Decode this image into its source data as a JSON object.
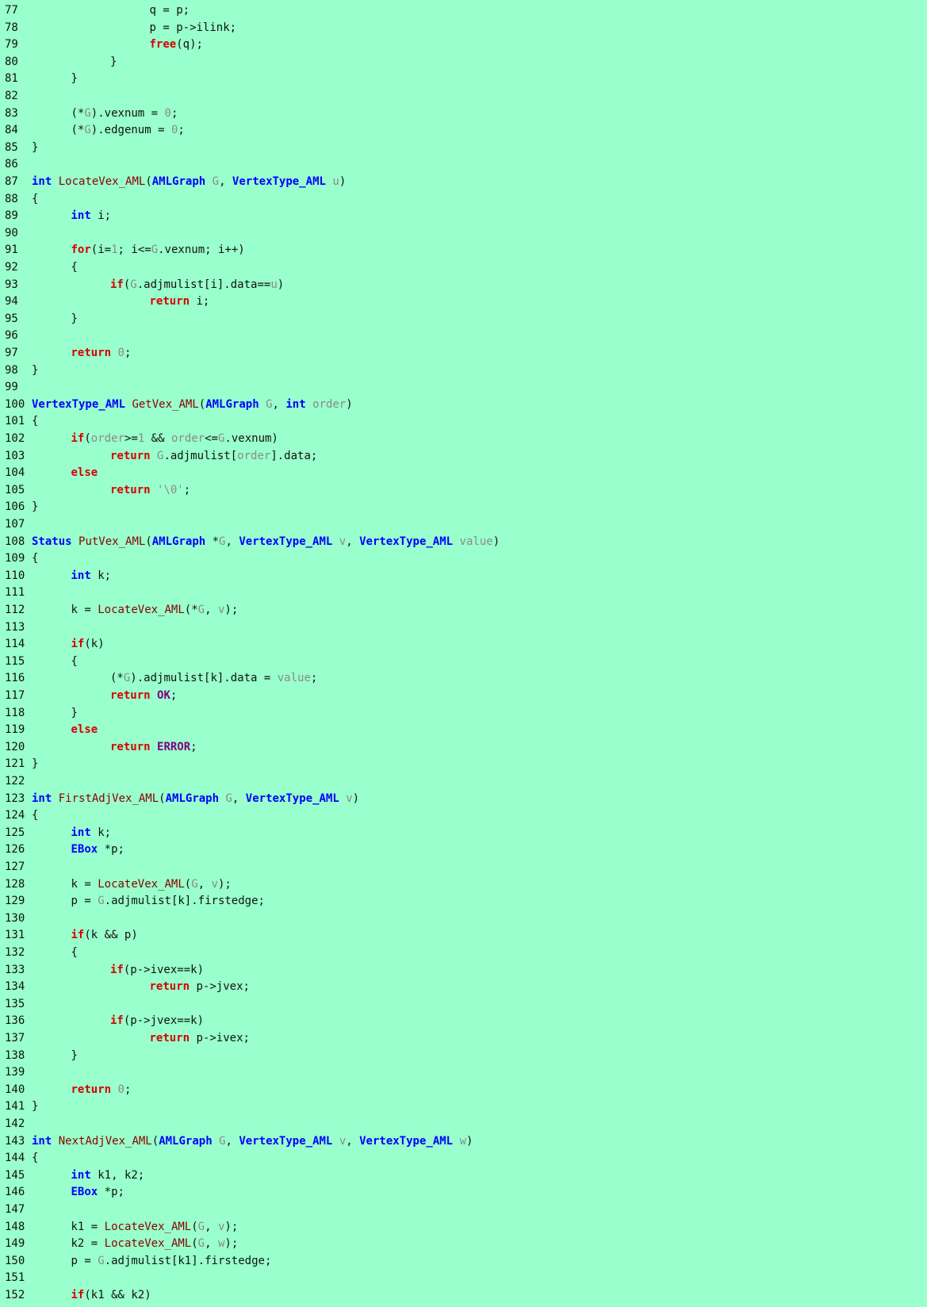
{
  "colors": {
    "background": "#99ffcc",
    "keyword": "#d60000",
    "type": "#0000ff",
    "function": "#8b0000",
    "identifier": "#8a8a8a",
    "constant": "#800080",
    "text": "#111111"
  },
  "lines": [
    {
      "n": "77",
      "indent": 3,
      "tokens": [
        [
          "plain",
          "q = p;"
        ]
      ]
    },
    {
      "n": "78",
      "indent": 3,
      "tokens": [
        [
          "plain",
          "p = p->ilink;"
        ]
      ]
    },
    {
      "n": "79",
      "indent": 3,
      "tokens": [
        [
          "kw",
          "free"
        ],
        [
          "plain",
          "(q);"
        ]
      ]
    },
    {
      "n": "80",
      "indent": 2,
      "tokens": [
        [
          "plain",
          "}"
        ]
      ]
    },
    {
      "n": "81",
      "indent": 1,
      "tokens": [
        [
          "plain",
          "}"
        ]
      ]
    },
    {
      "n": "82",
      "indent": 0,
      "tokens": []
    },
    {
      "n": "83",
      "indent": 1,
      "tokens": [
        [
          "plain",
          "(*"
        ],
        [
          "id",
          "G"
        ],
        [
          "plain",
          ").vexnum = "
        ],
        [
          "num",
          "0"
        ],
        [
          "plain",
          ";"
        ]
      ]
    },
    {
      "n": "84",
      "indent": 1,
      "tokens": [
        [
          "plain",
          "(*"
        ],
        [
          "id",
          "G"
        ],
        [
          "plain",
          ").edgenum = "
        ],
        [
          "num",
          "0"
        ],
        [
          "plain",
          ";"
        ]
      ]
    },
    {
      "n": "85",
      "indent": 0,
      "tokens": [
        [
          "plain",
          "}"
        ]
      ]
    },
    {
      "n": "86",
      "indent": 0,
      "tokens": []
    },
    {
      "n": "87",
      "indent": 0,
      "tokens": [
        [
          "type",
          "int"
        ],
        [
          "plain",
          " "
        ],
        [
          "fn",
          "LocateVex_AML"
        ],
        [
          "plain",
          "("
        ],
        [
          "type",
          "AMLGraph"
        ],
        [
          "plain",
          " "
        ],
        [
          "id",
          "G"
        ],
        [
          "plain",
          ", "
        ],
        [
          "type",
          "VertexType_AML"
        ],
        [
          "plain",
          " "
        ],
        [
          "id",
          "u"
        ],
        [
          "plain",
          ")"
        ]
      ]
    },
    {
      "n": "88",
      "indent": 0,
      "tokens": [
        [
          "plain",
          "{"
        ]
      ]
    },
    {
      "n": "89",
      "indent": 1,
      "tokens": [
        [
          "type",
          "int"
        ],
        [
          "plain",
          " i;"
        ]
      ]
    },
    {
      "n": "90",
      "indent": 0,
      "tokens": []
    },
    {
      "n": "91",
      "indent": 1,
      "tokens": [
        [
          "kw",
          "for"
        ],
        [
          "plain",
          "(i="
        ],
        [
          "num",
          "1"
        ],
        [
          "plain",
          "; i<="
        ],
        [
          "id",
          "G"
        ],
        [
          "plain",
          ".vexnum; i++)"
        ]
      ]
    },
    {
      "n": "92",
      "indent": 1,
      "tokens": [
        [
          "plain",
          "{"
        ]
      ]
    },
    {
      "n": "93",
      "indent": 2,
      "tokens": [
        [
          "kw",
          "if"
        ],
        [
          "plain",
          "("
        ],
        [
          "id",
          "G"
        ],
        [
          "plain",
          ".adjmulist[i].data=="
        ],
        [
          "id",
          "u"
        ],
        [
          "plain",
          ")"
        ]
      ]
    },
    {
      "n": "94",
      "indent": 3,
      "tokens": [
        [
          "kw",
          "return"
        ],
        [
          "plain",
          " i;"
        ]
      ]
    },
    {
      "n": "95",
      "indent": 1,
      "tokens": [
        [
          "plain",
          "}"
        ]
      ]
    },
    {
      "n": "96",
      "indent": 0,
      "tokens": []
    },
    {
      "n": "97",
      "indent": 1,
      "tokens": [
        [
          "kw",
          "return"
        ],
        [
          "plain",
          " "
        ],
        [
          "num",
          "0"
        ],
        [
          "plain",
          ";"
        ]
      ]
    },
    {
      "n": "98",
      "indent": 0,
      "tokens": [
        [
          "plain",
          "}"
        ]
      ]
    },
    {
      "n": "99",
      "indent": 0,
      "tokens": []
    },
    {
      "n": "100",
      "indent": 0,
      "tokens": [
        [
          "type",
          "VertexType_AML"
        ],
        [
          "plain",
          " "
        ],
        [
          "fn",
          "GetVex_AML"
        ],
        [
          "plain",
          "("
        ],
        [
          "type",
          "AMLGraph"
        ],
        [
          "plain",
          " "
        ],
        [
          "id",
          "G"
        ],
        [
          "plain",
          ", "
        ],
        [
          "type",
          "int"
        ],
        [
          "plain",
          " "
        ],
        [
          "id",
          "order"
        ],
        [
          "plain",
          ")"
        ]
      ]
    },
    {
      "n": "101",
      "indent": 0,
      "tokens": [
        [
          "plain",
          "{"
        ]
      ]
    },
    {
      "n": "102",
      "indent": 1,
      "tokens": [
        [
          "kw",
          "if"
        ],
        [
          "plain",
          "("
        ],
        [
          "id",
          "order"
        ],
        [
          "plain",
          ">="
        ],
        [
          "num",
          "1"
        ],
        [
          "plain",
          " && "
        ],
        [
          "id",
          "order"
        ],
        [
          "plain",
          "<="
        ],
        [
          "id",
          "G"
        ],
        [
          "plain",
          ".vexnum)"
        ]
      ]
    },
    {
      "n": "103",
      "indent": 2,
      "tokens": [
        [
          "kw",
          "return"
        ],
        [
          "plain",
          " "
        ],
        [
          "id",
          "G"
        ],
        [
          "plain",
          ".adjmulist["
        ],
        [
          "id",
          "order"
        ],
        [
          "plain",
          "].data;"
        ]
      ]
    },
    {
      "n": "104",
      "indent": 1,
      "tokens": [
        [
          "kw",
          "else"
        ]
      ]
    },
    {
      "n": "105",
      "indent": 2,
      "tokens": [
        [
          "kw",
          "return"
        ],
        [
          "plain",
          " "
        ],
        [
          "str",
          "'\\0'"
        ],
        [
          "plain",
          ";"
        ]
      ]
    },
    {
      "n": "106",
      "indent": 0,
      "tokens": [
        [
          "plain",
          "}"
        ]
      ]
    },
    {
      "n": "107",
      "indent": 0,
      "tokens": []
    },
    {
      "n": "108",
      "indent": 0,
      "tokens": [
        [
          "type",
          "Status"
        ],
        [
          "plain",
          " "
        ],
        [
          "fn",
          "PutVex_AML"
        ],
        [
          "plain",
          "("
        ],
        [
          "type",
          "AMLGraph"
        ],
        [
          "plain",
          " *"
        ],
        [
          "id",
          "G"
        ],
        [
          "plain",
          ", "
        ],
        [
          "type",
          "VertexType_AML"
        ],
        [
          "plain",
          " "
        ],
        [
          "id",
          "v"
        ],
        [
          "plain",
          ", "
        ],
        [
          "type",
          "VertexType_AML"
        ],
        [
          "plain",
          " "
        ],
        [
          "id",
          "value"
        ],
        [
          "plain",
          ")"
        ]
      ]
    },
    {
      "n": "109",
      "indent": 0,
      "tokens": [
        [
          "plain",
          "{"
        ]
      ]
    },
    {
      "n": "110",
      "indent": 1,
      "tokens": [
        [
          "type",
          "int"
        ],
        [
          "plain",
          " k;"
        ]
      ]
    },
    {
      "n": "111",
      "indent": 0,
      "tokens": []
    },
    {
      "n": "112",
      "indent": 1,
      "tokens": [
        [
          "plain",
          "k = "
        ],
        [
          "fn",
          "LocateVex_AML"
        ],
        [
          "plain",
          "(*"
        ],
        [
          "id",
          "G"
        ],
        [
          "plain",
          ", "
        ],
        [
          "id",
          "v"
        ],
        [
          "plain",
          ");"
        ]
      ]
    },
    {
      "n": "113",
      "indent": 0,
      "tokens": []
    },
    {
      "n": "114",
      "indent": 1,
      "tokens": [
        [
          "kw",
          "if"
        ],
        [
          "plain",
          "(k)"
        ]
      ]
    },
    {
      "n": "115",
      "indent": 1,
      "tokens": [
        [
          "plain",
          "{"
        ]
      ]
    },
    {
      "n": "116",
      "indent": 2,
      "tokens": [
        [
          "plain",
          "(*"
        ],
        [
          "id",
          "G"
        ],
        [
          "plain",
          ").adjmulist[k].data = "
        ],
        [
          "id",
          "value"
        ],
        [
          "plain",
          ";"
        ]
      ]
    },
    {
      "n": "117",
      "indent": 2,
      "tokens": [
        [
          "kw",
          "return"
        ],
        [
          "plain",
          " "
        ],
        [
          "const",
          "OK"
        ],
        [
          "plain",
          ";"
        ]
      ]
    },
    {
      "n": "118",
      "indent": 1,
      "tokens": [
        [
          "plain",
          "}"
        ]
      ]
    },
    {
      "n": "119",
      "indent": 1,
      "tokens": [
        [
          "kw",
          "else"
        ]
      ]
    },
    {
      "n": "120",
      "indent": 2,
      "tokens": [
        [
          "kw",
          "return"
        ],
        [
          "plain",
          " "
        ],
        [
          "const",
          "ERROR"
        ],
        [
          "plain",
          ";"
        ]
      ]
    },
    {
      "n": "121",
      "indent": 0,
      "tokens": [
        [
          "plain",
          "}"
        ]
      ]
    },
    {
      "n": "122",
      "indent": 0,
      "tokens": []
    },
    {
      "n": "123",
      "indent": 0,
      "tokens": [
        [
          "type",
          "int"
        ],
        [
          "plain",
          " "
        ],
        [
          "fn",
          "FirstAdjVex_AML"
        ],
        [
          "plain",
          "("
        ],
        [
          "type",
          "AMLGraph"
        ],
        [
          "plain",
          " "
        ],
        [
          "id",
          "G"
        ],
        [
          "plain",
          ", "
        ],
        [
          "type",
          "VertexType_AML"
        ],
        [
          "plain",
          " "
        ],
        [
          "id",
          "v"
        ],
        [
          "plain",
          ")"
        ]
      ]
    },
    {
      "n": "124",
      "indent": 0,
      "tokens": [
        [
          "plain",
          "{"
        ]
      ]
    },
    {
      "n": "125",
      "indent": 1,
      "tokens": [
        [
          "type",
          "int"
        ],
        [
          "plain",
          " k;"
        ]
      ]
    },
    {
      "n": "126",
      "indent": 1,
      "tokens": [
        [
          "type",
          "EBox"
        ],
        [
          "plain",
          " *p;"
        ]
      ]
    },
    {
      "n": "127",
      "indent": 0,
      "tokens": []
    },
    {
      "n": "128",
      "indent": 1,
      "tokens": [
        [
          "plain",
          "k = "
        ],
        [
          "fn",
          "LocateVex_AML"
        ],
        [
          "plain",
          "("
        ],
        [
          "id",
          "G"
        ],
        [
          "plain",
          ", "
        ],
        [
          "id",
          "v"
        ],
        [
          "plain",
          ");"
        ]
      ]
    },
    {
      "n": "129",
      "indent": 1,
      "tokens": [
        [
          "plain",
          "p = "
        ],
        [
          "id",
          "G"
        ],
        [
          "plain",
          ".adjmulist[k].firstedge;"
        ]
      ]
    },
    {
      "n": "130",
      "indent": 0,
      "tokens": []
    },
    {
      "n": "131",
      "indent": 1,
      "tokens": [
        [
          "kw",
          "if"
        ],
        [
          "plain",
          "(k && p)"
        ]
      ]
    },
    {
      "n": "132",
      "indent": 1,
      "tokens": [
        [
          "plain",
          "{"
        ]
      ]
    },
    {
      "n": "133",
      "indent": 2,
      "tokens": [
        [
          "kw",
          "if"
        ],
        [
          "plain",
          "(p->ivex==k)"
        ]
      ]
    },
    {
      "n": "134",
      "indent": 3,
      "tokens": [
        [
          "kw",
          "return"
        ],
        [
          "plain",
          " p->jvex;"
        ]
      ]
    },
    {
      "n": "135",
      "indent": 0,
      "tokens": []
    },
    {
      "n": "136",
      "indent": 2,
      "tokens": [
        [
          "kw",
          "if"
        ],
        [
          "plain",
          "(p->jvex==k)"
        ]
      ]
    },
    {
      "n": "137",
      "indent": 3,
      "tokens": [
        [
          "kw",
          "return"
        ],
        [
          "plain",
          " p->ivex;"
        ]
      ]
    },
    {
      "n": "138",
      "indent": 1,
      "tokens": [
        [
          "plain",
          "}"
        ]
      ]
    },
    {
      "n": "139",
      "indent": 0,
      "tokens": []
    },
    {
      "n": "140",
      "indent": 1,
      "tokens": [
        [
          "kw",
          "return"
        ],
        [
          "plain",
          " "
        ],
        [
          "num",
          "0"
        ],
        [
          "plain",
          ";"
        ]
      ]
    },
    {
      "n": "141",
      "indent": 0,
      "tokens": [
        [
          "plain",
          "}"
        ]
      ]
    },
    {
      "n": "142",
      "indent": 0,
      "tokens": []
    },
    {
      "n": "143",
      "indent": 0,
      "tokens": [
        [
          "type",
          "int"
        ],
        [
          "plain",
          " "
        ],
        [
          "fn",
          "NextAdjVex_AML"
        ],
        [
          "plain",
          "("
        ],
        [
          "type",
          "AMLGraph"
        ],
        [
          "plain",
          " "
        ],
        [
          "id",
          "G"
        ],
        [
          "plain",
          ", "
        ],
        [
          "type",
          "VertexType_AML"
        ],
        [
          "plain",
          " "
        ],
        [
          "id",
          "v"
        ],
        [
          "plain",
          ", "
        ],
        [
          "type",
          "VertexType_AML"
        ],
        [
          "plain",
          " "
        ],
        [
          "id",
          "w"
        ],
        [
          "plain",
          ")"
        ]
      ]
    },
    {
      "n": "144",
      "indent": 0,
      "tokens": [
        [
          "plain",
          "{"
        ]
      ]
    },
    {
      "n": "145",
      "indent": 1,
      "tokens": [
        [
          "type",
          "int"
        ],
        [
          "plain",
          " k1, k2;"
        ]
      ]
    },
    {
      "n": "146",
      "indent": 1,
      "tokens": [
        [
          "type",
          "EBox"
        ],
        [
          "plain",
          " *p;"
        ]
      ]
    },
    {
      "n": "147",
      "indent": 0,
      "tokens": []
    },
    {
      "n": "148",
      "indent": 1,
      "tokens": [
        [
          "plain",
          "k1 = "
        ],
        [
          "fn",
          "LocateVex_AML"
        ],
        [
          "plain",
          "("
        ],
        [
          "id",
          "G"
        ],
        [
          "plain",
          ", "
        ],
        [
          "id",
          "v"
        ],
        [
          "plain",
          ");"
        ]
      ]
    },
    {
      "n": "149",
      "indent": 1,
      "tokens": [
        [
          "plain",
          "k2 = "
        ],
        [
          "fn",
          "LocateVex_AML"
        ],
        [
          "plain",
          "("
        ],
        [
          "id",
          "G"
        ],
        [
          "plain",
          ", "
        ],
        [
          "id",
          "w"
        ],
        [
          "plain",
          ");"
        ]
      ]
    },
    {
      "n": "150",
      "indent": 1,
      "tokens": [
        [
          "plain",
          "p = "
        ],
        [
          "id",
          "G"
        ],
        [
          "plain",
          ".adjmulist[k1].firstedge;"
        ]
      ]
    },
    {
      "n": "151",
      "indent": 0,
      "tokens": []
    },
    {
      "n": "152",
      "indent": 1,
      "tokens": [
        [
          "kw",
          "if"
        ],
        [
          "plain",
          "(k1 && k2)"
        ]
      ]
    }
  ]
}
